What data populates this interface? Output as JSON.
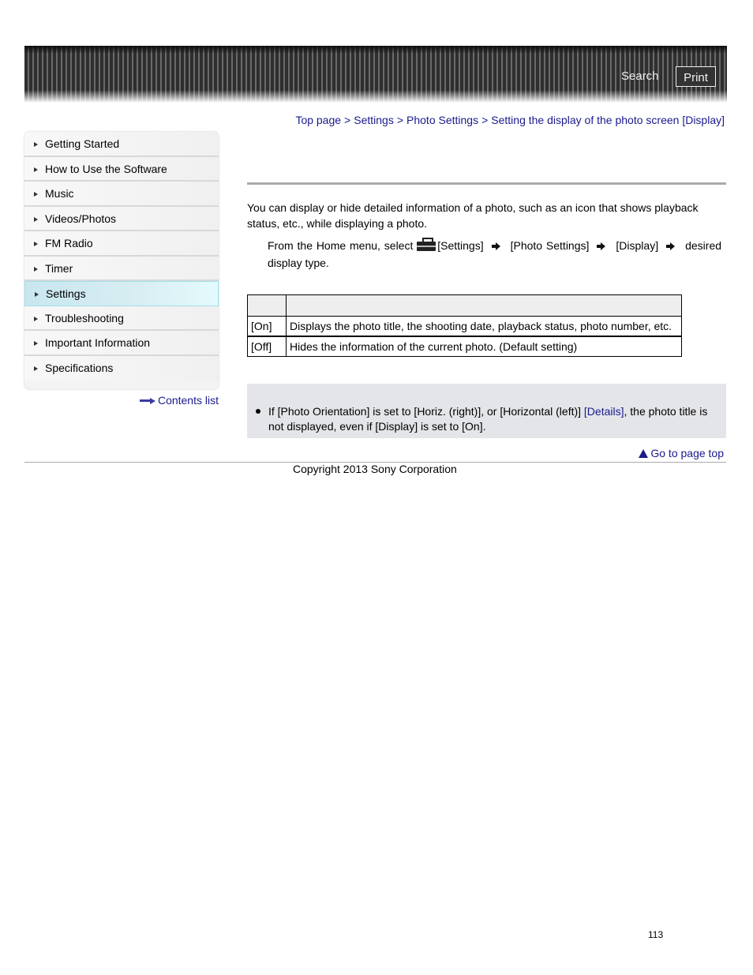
{
  "header": {
    "search_label": "Search",
    "print_label": "Print"
  },
  "breadcrumb": {
    "items": [
      "Top page",
      "Settings",
      "Photo Settings",
      "Setting the display of the photo screen [Display]"
    ],
    "separator": ">"
  },
  "sidebar": {
    "items": [
      {
        "label": "Getting Started"
      },
      {
        "label": "How to Use the Software"
      },
      {
        "label": "Music"
      },
      {
        "label": "Videos/Photos"
      },
      {
        "label": "FM Radio"
      },
      {
        "label": "Timer"
      },
      {
        "label": "Settings",
        "active": true
      },
      {
        "label": "Troubleshooting"
      },
      {
        "label": "Important Information"
      },
      {
        "label": "Specifications"
      }
    ],
    "contents_list_label": "Contents list"
  },
  "content": {
    "intro": "You can display or hide detailed information of a photo, such as an icon that shows playback status, etc., while displaying a photo.",
    "step": {
      "prefix": "From the Home menu, select",
      "icon": "settings-toolbox-icon",
      "parts": [
        "[Settings]",
        "[Photo Settings]",
        "[Display]",
        "desired display type."
      ]
    },
    "table": {
      "header": [
        "",
        ""
      ],
      "rows": [
        [
          "[On]",
          "Displays the photo title, the shooting date, playback status, photo number, etc."
        ],
        [
          "[Off]",
          "Hides the information of the current photo. (Default setting)"
        ]
      ]
    },
    "note": {
      "text_before": "If [Photo Orientation] is set to [Horiz. (right)], or [Horizontal (left)] ",
      "link": "[Details]",
      "text_after": ", the photo title is not displayed, even if [Display] is set to [On]."
    }
  },
  "footer": {
    "go_to_top_label": "Go to page top",
    "copyright": "Copyright 2013 Sony Corporation",
    "page_number": "113"
  },
  "colors": {
    "link": "#1a1a8c",
    "active_nav": "#d8eef3",
    "note_bg": "#e4e5e9"
  }
}
